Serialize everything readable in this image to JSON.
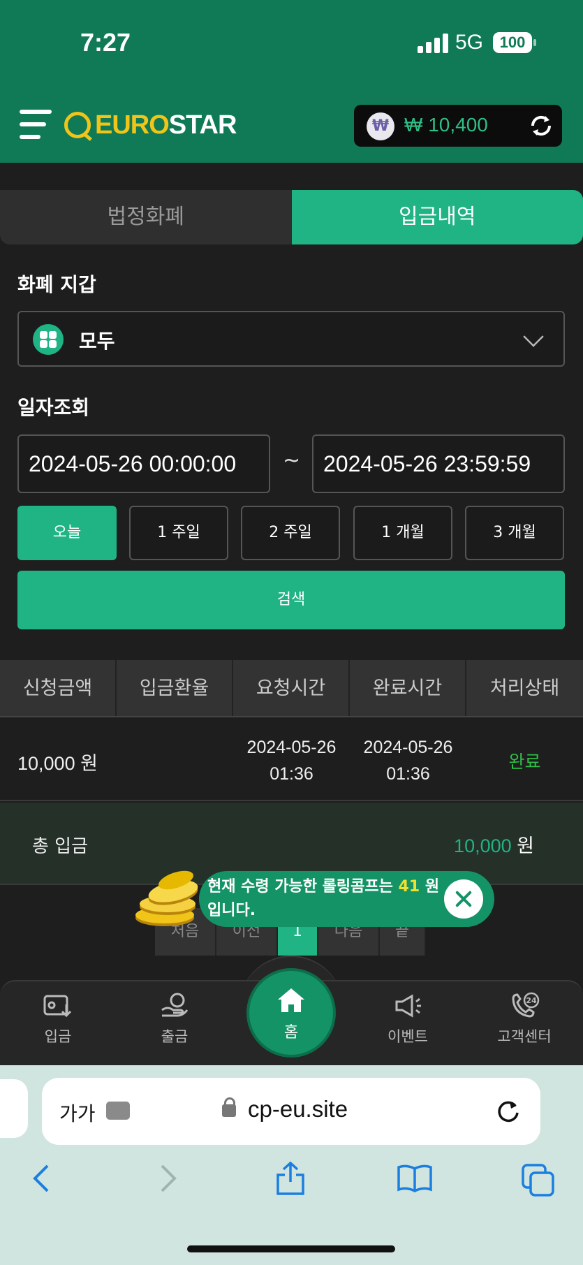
{
  "status_bar": {
    "time": "7:27",
    "network": "5G",
    "battery": "100"
  },
  "header": {
    "logo_euro": "EURO",
    "logo_star": "STAR",
    "balance": "₩ 10,400",
    "currency_symbol": "₩"
  },
  "tabs": [
    {
      "label": "법정화폐",
      "active": false
    },
    {
      "label": "입금내역",
      "active": true
    }
  ],
  "wallet": {
    "label": "화폐 지갑",
    "selected": "모두"
  },
  "date_filter": {
    "label": "일자조회",
    "from": "2024-05-26 00:00:00",
    "to": "2024-05-26 23:59:59",
    "separator": "~",
    "ranges": [
      "오늘",
      "1 주일",
      "2 주일",
      "1 개월",
      "3 개월"
    ],
    "active_range": "오늘",
    "search_label": "검색"
  },
  "table": {
    "headers": [
      "신청금액",
      "입금환율",
      "요청시간",
      "완료시간",
      "처리상태"
    ],
    "rows": [
      {
        "amount": "10,000 원",
        "rate": "",
        "requested_date": "2024-05-26",
        "requested_time": "01:36",
        "completed_date": "2024-05-26",
        "completed_time": "01:36",
        "status": "완료"
      }
    ]
  },
  "total": {
    "label": "총 입금",
    "value": "10,000",
    "unit": "원"
  },
  "pager": {
    "first": "처음",
    "prev": "이전",
    "current": "1",
    "next": "다음",
    "last": "끝"
  },
  "toast": {
    "text_before": "현재 수령 가능한 롤링콤프는 ",
    "amount": "41",
    "text_after": " 원 입니다."
  },
  "bottom_nav": {
    "deposit": "입금",
    "withdraw": "출금",
    "home": "홈",
    "event": "이벤트",
    "support": "고객센터",
    "support_badge": "24"
  },
  "browser": {
    "aa": "가가",
    "url": "cp-eu.site"
  },
  "colors": {
    "brand_green": "#0f7a55",
    "accent": "#20b383",
    "logo_yellow": "#f0c419",
    "status_done": "#2fbf46"
  }
}
